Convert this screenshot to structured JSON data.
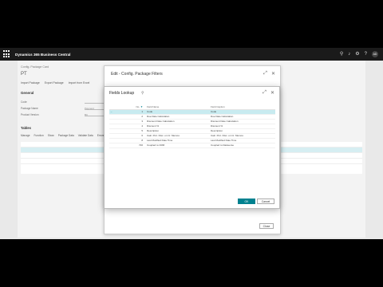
{
  "app": {
    "title": "Dynamics 365 Business Central",
    "avatar_initials": "AD"
  },
  "background_page": {
    "breadcrumb": "Config. Package Card",
    "code": "PT",
    "actions": [
      "Import Package",
      "Export Package",
      "Import from Excel"
    ],
    "section_general": "General",
    "fields": [
      {
        "label": "Code",
        "value": ""
      },
      {
        "label": "Package Name",
        "value": "Payment"
      },
      {
        "label": "Product Version",
        "value": "BC"
      }
    ],
    "section_tables": "Tables",
    "table_actions": [
      "Manage",
      "Function",
      "Show",
      "Package Data",
      "Validate Data",
      "Errors"
    ]
  },
  "edit_dialog": {
    "title": "Edit - Config. Package Filters",
    "close_label": "Close"
  },
  "lookup": {
    "title": "Fields Lookup",
    "columns": {
      "no": "No.",
      "field_name": "Field Name",
      "field_caption": "Field Caption"
    },
    "rows": [
      {
        "no": "1",
        "name": "Code",
        "caption": "Code",
        "selected": true
      },
      {
        "no": "2",
        "name": "Due Date Calculation",
        "caption": "Due Date Calculation"
      },
      {
        "no": "3",
        "name": "Discount Date Calculation",
        "caption": "Discount Date Calculation"
      },
      {
        "no": "4",
        "name": "Discount %",
        "caption": "Discount %"
      },
      {
        "no": "5",
        "name": "Description",
        "caption": "Description"
      },
      {
        "no": "6",
        "name": "Calc. Pmt. Disc. on Cr. Memos",
        "caption": "Calc. Pmt. Disc. on Cr. Memos"
      },
      {
        "no": "8",
        "name": "Last Modified Date Time",
        "caption": "Last Modified Date Time"
      },
      {
        "no": "720",
        "name": "Coupled to CRM",
        "caption": "Coupled to Dataverse"
      }
    ],
    "ok_label": "OK",
    "cancel_label": "Cancel"
  }
}
